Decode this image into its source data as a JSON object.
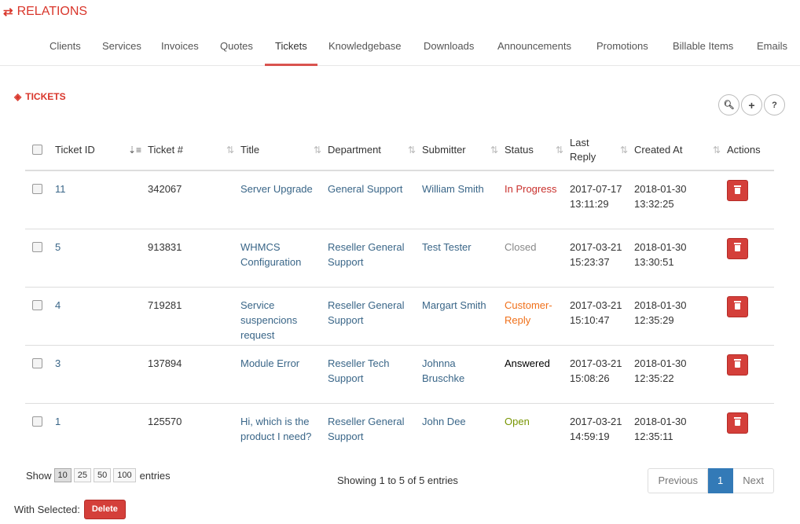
{
  "header": {
    "icon": "exchange-icon",
    "title": "RELATIONS",
    "accent": "#d9362b"
  },
  "tabs": [
    {
      "label": "Clients"
    },
    {
      "label": "Services"
    },
    {
      "label": "Invoices"
    },
    {
      "label": "Quotes"
    },
    {
      "label": "Tickets",
      "active": true
    },
    {
      "label": "Knowledgebase"
    },
    {
      "label": "Downloads"
    },
    {
      "label": "Announcements"
    },
    {
      "label": "Promotions"
    },
    {
      "label": "Billable Items"
    },
    {
      "label": "Emails"
    }
  ],
  "section": {
    "icon": "ticket-icon",
    "title": "TICKETS"
  },
  "tools": {
    "search": "search-icon",
    "add": "plus-icon",
    "help": "?"
  },
  "table": {
    "headers": {
      "ticket_id": "Ticket ID",
      "ticket_num": "Ticket #",
      "title": "Title",
      "department": "Department",
      "submitter": "Submitter",
      "status": "Status",
      "last_reply": "Last Reply",
      "created_at": "Created At",
      "actions": "Actions"
    },
    "rows": [
      {
        "id": "11",
        "num": "342067",
        "title": "Server Upgrade",
        "department": "General Support",
        "submitter": "William Smith",
        "status": "In Progress",
        "last_reply": "2017-07-17 13:11:29",
        "created": "2018-01-30 13:32:25"
      },
      {
        "id": "5",
        "num": "913831",
        "title": "WHMCS Configuration",
        "department": "Reseller General Support",
        "submitter": "Test Tester",
        "status": "Closed",
        "last_reply": "2017-03-21 15:23:37",
        "created": "2018-01-30 13:30:51"
      },
      {
        "id": "4",
        "num": "719281",
        "title": "Service suspencions request",
        "department": "Reseller General Support",
        "submitter": "Margart Smith",
        "status": "Customer-Reply",
        "last_reply": "2017-03-21 15:10:47",
        "created": "2018-01-30 12:35:29"
      },
      {
        "id": "3",
        "num": "137894",
        "title": "Module Error",
        "department": "Reseller Tech Support",
        "submitter": "Johnna Bruschke",
        "status": "Answered",
        "last_reply": "2017-03-21 15:08:26",
        "created": "2018-01-30 12:35:22"
      },
      {
        "id": "1",
        "num": "125570",
        "title": "Hi, which is the product I need?",
        "department": "Reseller General Support",
        "submitter": "John Dee",
        "status": "Open",
        "last_reply": "2017-03-21 14:59:19",
        "created": "2018-01-30 12:35:11"
      }
    ]
  },
  "length": {
    "show": "Show",
    "entries": "entries",
    "options": [
      "10",
      "25",
      "50",
      "100"
    ],
    "selected": "10"
  },
  "info": "Showing 1 to 5 of 5 entries",
  "pager": {
    "previous": "Previous",
    "page": "1",
    "next": "Next"
  },
  "bulk": {
    "label": "With Selected:",
    "delete": "Delete"
  },
  "colors": {
    "link": "#3a6688",
    "danger": "#d43f3a",
    "primary": "#337ab7"
  }
}
